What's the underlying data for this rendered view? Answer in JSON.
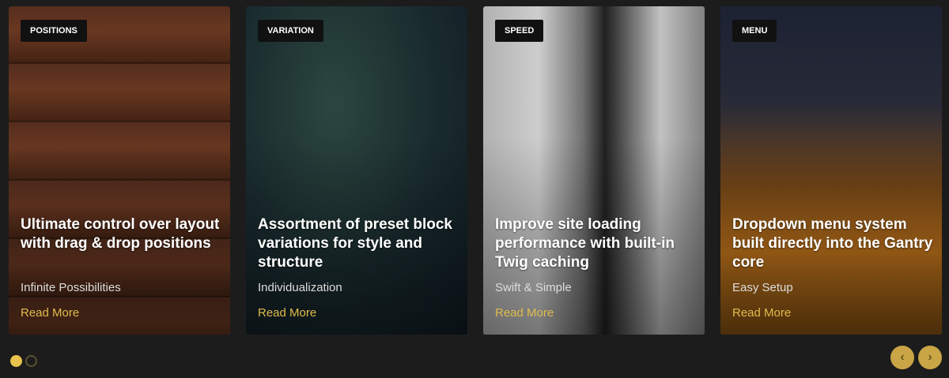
{
  "cards": [
    {
      "badge": "POSITIONS",
      "title": "Ultimate control over layout with drag & drop positions",
      "subtitle": "Infinite Possibilities",
      "link": "Read More"
    },
    {
      "badge": "VARIATION",
      "title": "Assortment of preset block variations for style and structure",
      "subtitle": "Individualization",
      "link": "Read More"
    },
    {
      "badge": "SPEED",
      "title": "Improve site loading performance with built-in Twig caching",
      "subtitle": "Swift & Simple",
      "link": "Read More"
    },
    {
      "badge": "MENU",
      "title": "Dropdown menu system built directly into the Gantry core",
      "subtitle": "Easy Setup",
      "link": "Read More"
    }
  ],
  "pagination": {
    "active": 0,
    "total": 2
  },
  "nav": {
    "prev": "‹",
    "next": "›"
  },
  "colors": {
    "accent": "#e0bb4c",
    "background": "#1c1c1c"
  }
}
